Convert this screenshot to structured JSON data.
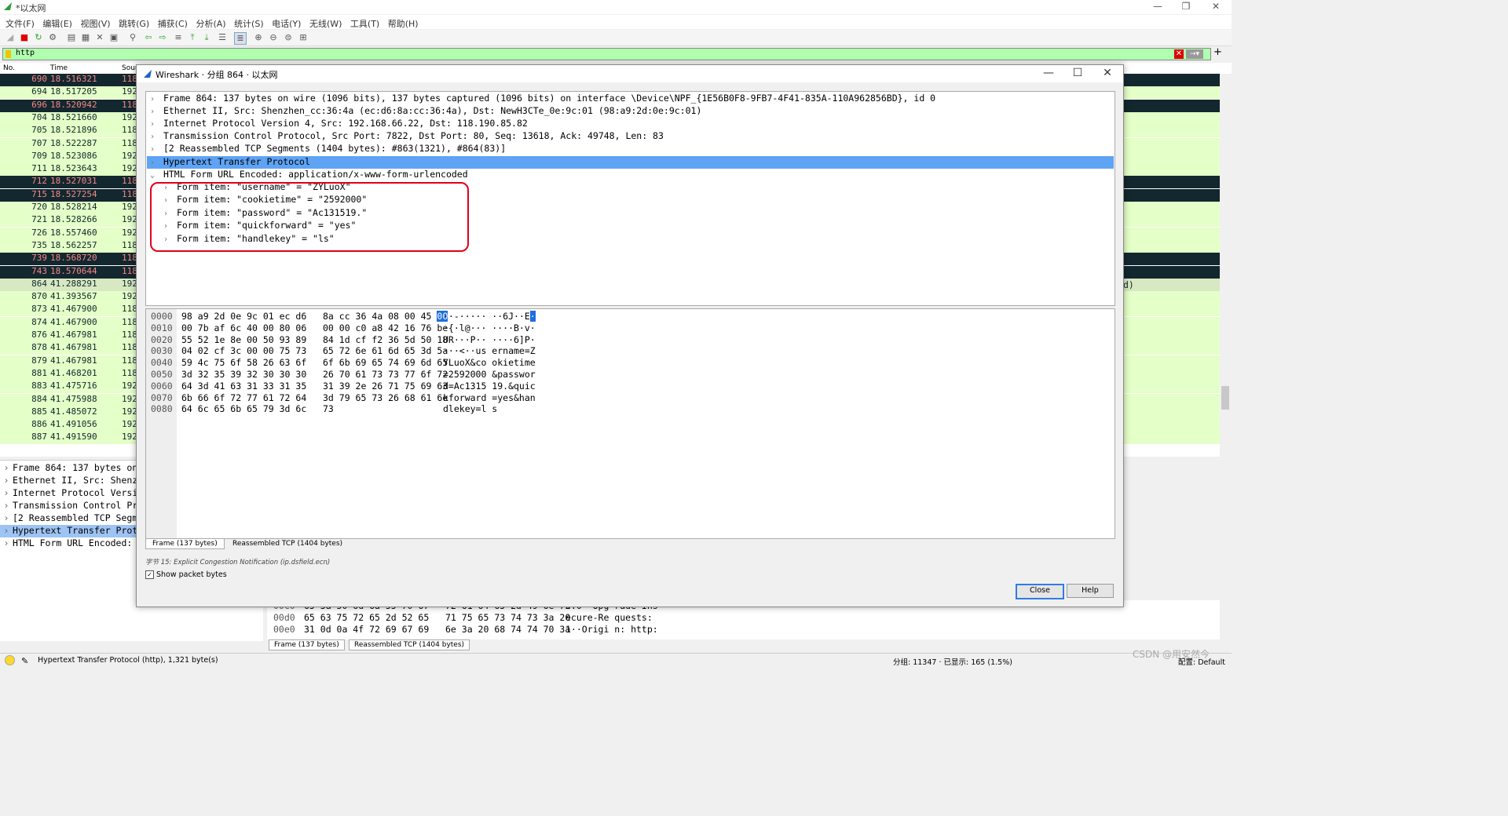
{
  "app": {
    "title": "*以太网"
  },
  "window_controls": {
    "minimize": "—",
    "restore": "❐",
    "close": "✕"
  },
  "menu": [
    "文件(F)",
    "编辑(E)",
    "视图(V)",
    "跳转(G)",
    "捕获(C)",
    "分析(A)",
    "统计(S)",
    "电话(Y)",
    "无线(W)",
    "工具(T)",
    "帮助(H)"
  ],
  "filter": {
    "value": "http"
  },
  "packet_list": {
    "columns": [
      "No.",
      "Time",
      "Sour"
    ],
    "rows": [
      {
        "no": "690",
        "time": "18.516321",
        "src": "118",
        "style": "d"
      },
      {
        "no": "694",
        "time": "18.517205",
        "src": "192",
        "style": "g"
      },
      {
        "no": "696",
        "time": "18.520942",
        "src": "118",
        "style": "d"
      },
      {
        "no": "704",
        "time": "18.521660",
        "src": "192",
        "style": "g"
      },
      {
        "no": "705",
        "time": "18.521896",
        "src": "118",
        "style": "g"
      },
      {
        "no": "707",
        "time": "18.522287",
        "src": "118",
        "style": "g"
      },
      {
        "no": "709",
        "time": "18.523086",
        "src": "192",
        "style": "g"
      },
      {
        "no": "711",
        "time": "18.523643",
        "src": "192",
        "style": "g"
      },
      {
        "no": "712",
        "time": "18.527031",
        "src": "118",
        "style": "d"
      },
      {
        "no": "715",
        "time": "18.527254",
        "src": "118",
        "style": "d"
      },
      {
        "no": "720",
        "time": "18.528214",
        "src": "192",
        "style": "g"
      },
      {
        "no": "721",
        "time": "18.528266",
        "src": "192",
        "style": "g"
      },
      {
        "no": "726",
        "time": "18.557460",
        "src": "192",
        "style": "g"
      },
      {
        "no": "735",
        "time": "18.562257",
        "src": "118",
        "style": "g"
      },
      {
        "no": "739",
        "time": "18.568720",
        "src": "118",
        "style": "d"
      },
      {
        "no": "743",
        "time": "18.570644",
        "src": "118",
        "style": "d"
      },
      {
        "no": "864",
        "time": "41.288291",
        "src": "192",
        "style": "sel"
      },
      {
        "no": "870",
        "time": "41.393567",
        "src": "192",
        "style": "g"
      },
      {
        "no": "873",
        "time": "41.467900",
        "src": "118",
        "style": "g"
      },
      {
        "no": "874",
        "time": "41.467900",
        "src": "118",
        "style": "g"
      },
      {
        "no": "876",
        "time": "41.467981",
        "src": "118",
        "style": "g"
      },
      {
        "no": "878",
        "time": "41.467981",
        "src": "118",
        "style": "g"
      },
      {
        "no": "879",
        "time": "41.467981",
        "src": "118",
        "style": "g"
      },
      {
        "no": "881",
        "time": "41.468201",
        "src": "118",
        "style": "g"
      },
      {
        "no": "883",
        "time": "41.475716",
        "src": "192",
        "style": "g"
      },
      {
        "no": "884",
        "time": "41.475988",
        "src": "192",
        "style": "g"
      },
      {
        "no": "885",
        "time": "41.485072",
        "src": "192",
        "style": "g"
      },
      {
        "no": "886",
        "time": "41.491056",
        "src": "192",
        "style": "g"
      },
      {
        "no": "887",
        "time": "41.491590",
        "src": "192",
        "style": "g"
      }
    ],
    "right_fragment": "d)"
  },
  "details_pane": {
    "lines": [
      "Frame 864: 137 bytes on",
      "Ethernet II, Src: Shenzh",
      "Internet Protocol Versio",
      "Transmission Control Pro",
      "[2 Reassembled TCP Segme",
      "Hypertext Transfer Proto",
      "HTML Form URL Encoded: a"
    ]
  },
  "bytes_pane": {
    "lines": [
      {
        "off": "00c0",
        "hex": "65 3a 50 6d 6a 55 70 67   72 61 64 65 2d 49 6e 73",
        "ascii": "e:0··Upg rade-Ins"
      },
      {
        "off": "00d0",
        "hex": "65 63 75 72 65 2d 52 65   71 75 65 73 74 73 3a 20",
        "ascii": "ecure-Re quests: "
      },
      {
        "off": "00e0",
        "hex": "31 0d 0a 4f 72 69 67 69   6e 3a 20 68 74 74 70 3a",
        "ascii": "1··Origi n: http:"
      }
    ],
    "tabs": [
      "Frame (137 bytes)",
      "Reassembled TCP (1404 bytes)"
    ]
  },
  "status": {
    "protocol": "Hypertext Transfer Protocol (http), 1,321 byte(s)",
    "counts": "分组: 11347 · 已显示: 165 (1.5%)",
    "profile": "配置: Default",
    "watermark": "CSDN @用安然今"
  },
  "dialog": {
    "title": "Wireshark · 分组 864 · 以太网",
    "tree": [
      "Frame 864: 137 bytes on wire (1096 bits), 137 bytes captured (1096 bits) on interface \\Device\\NPF_{1E56B0F8-9FB7-4F41-835A-110A962856BD}, id 0",
      "Ethernet II, Src: Shenzhen_cc:36:4a (ec:d6:8a:cc:36:4a), Dst: NewH3CTe_0e:9c:01 (98:a9:2d:0e:9c:01)",
      "Internet Protocol Version 4, Src: 192.168.66.22, Dst: 118.190.85.82",
      "Transmission Control Protocol, Src Port: 7822, Dst Port: 80, Seq: 13618, Ack: 49748, Len: 83",
      "[2 Reassembled TCP Segments (1404 bytes): #863(1321), #864(83)]",
      "Hypertext Transfer Protocol",
      "HTML Form URL Encoded: application/x-www-form-urlencoded"
    ],
    "form_items": [
      "Form item: \"username\" = \"ZYLuoX\"",
      "Form item: \"cookietime\" = \"2592000\"",
      "Form item: \"password\" = \"Ac131519.\"",
      "Form item: \"quickforward\" = \"yes\"",
      "Form item: \"handlekey\" = \"ls\""
    ],
    "hex": [
      {
        "off": "0000",
        "hex": "98 a9 2d 0e 9c 01 ec d6   8a cc 36 4a 08 00 45 ",
        "sel": "00",
        "ascii": "··-····· ··6J··E",
        "asel": "·"
      },
      {
        "off": "0010",
        "hex": "00 7b af 6c 40 00 80 06   00 00 c0 a8 42 16 76 be",
        "ascii": "·{·l@··· ····B·v·"
      },
      {
        "off": "0020",
        "hex": "55 52 1e 8e 00 50 93 89   84 1d cf f2 36 5d 50 18",
        "ascii": "UR···P·· ····6]P·"
      },
      {
        "off": "0030",
        "hex": "04 02 cf 3c 00 00 75 73   65 72 6e 61 6d 65 3d 5a",
        "ascii": "···<··us ername=Z"
      },
      {
        "off": "0040",
        "hex": "59 4c 75 6f 58 26 63 6f   6f 6b 69 65 74 69 6d 65",
        "ascii": "YLuoX&co okietime"
      },
      {
        "off": "0050",
        "hex": "3d 32 35 39 32 30 30 30   26 70 61 73 73 77 6f 72",
        "ascii": "=2592000 &passwor"
      },
      {
        "off": "0060",
        "hex": "64 3d 41 63 31 33 31 35   31 39 2e 26 71 75 69 63",
        "ascii": "d=Ac1315 19.&quic"
      },
      {
        "off": "0070",
        "hex": "6b 66 6f 72 77 61 72 64   3d 79 65 73 26 68 61 6e",
        "ascii": "kforward =yes&han"
      },
      {
        "off": "0080",
        "hex": "64 6c 65 6b 65 79 3d 6c   73",
        "ascii": "dlekey=l s"
      }
    ],
    "tabs": [
      "Frame (137 bytes)",
      "Reassembled TCP (1404 bytes)"
    ],
    "field_info": "字节 15: Explicit Congestion Notification (ip.dsfield.ecn)",
    "show_bytes_label": "Show packet bytes",
    "close_label": "Close",
    "help_label": "Help"
  }
}
